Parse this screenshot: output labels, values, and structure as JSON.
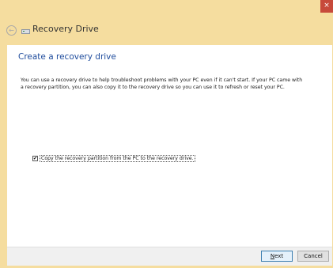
{
  "window": {
    "title": "Recovery Drive",
    "close_glyph": "×",
    "back_glyph": "←",
    "colors": {
      "frame": "#f5dd9f",
      "close_button": "#c74a3b",
      "heading": "#1e4b9c"
    }
  },
  "main": {
    "heading": "Create a recovery drive",
    "description": "You can use a recovery drive to help troubleshoot problems with your PC even if it can't start. If your PC came with a recovery partition, you can also copy it to the recovery drive so you can use it to refresh or reset your PC.",
    "copy_partition_checkbox": {
      "label": "Copy the recovery partition from the PC to the recovery drive.",
      "checked": true,
      "check_glyph": "✔"
    }
  },
  "footer": {
    "next_label": "Next",
    "cancel_label": "Cancel"
  },
  "icons": {
    "back": "back-arrow-icon",
    "drive": "drive-icon",
    "close": "close-icon"
  }
}
